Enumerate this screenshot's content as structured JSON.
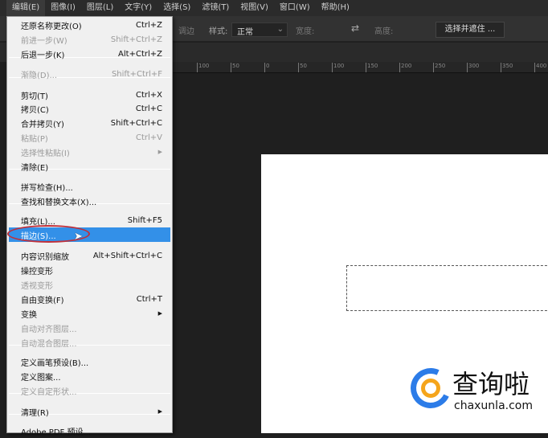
{
  "menubar": [
    "编辑(E)",
    "图像(I)",
    "图层(L)",
    "文字(Y)",
    "选择(S)",
    "滤镜(T)",
    "视图(V)",
    "窗口(W)",
    "帮助(H)"
  ],
  "options": {
    "feather_label": "调边",
    "style_label": "样式:",
    "style_value": "正常",
    "width_label": "宽度:",
    "height_label": "高度:",
    "select_mask_button": "选择并遮住 ..."
  },
  "ruler": [
    "100",
    "50",
    "0",
    "50",
    "100",
    "150",
    "200",
    "250",
    "300",
    "350",
    "400"
  ],
  "menu": [
    {
      "label": "还原名称更改(O)",
      "shortcut": "Ctrl+Z"
    },
    {
      "label": "前进一步(W)",
      "shortcut": "Shift+Ctrl+Z",
      "disabled": true
    },
    {
      "label": "后退一步(K)",
      "shortcut": "Alt+Ctrl+Z"
    },
    {
      "label": "渐隐(D)...",
      "shortcut": "Shift+Ctrl+F",
      "disabled": true
    },
    {
      "label": "剪切(T)",
      "shortcut": "Ctrl+X"
    },
    {
      "label": "拷贝(C)",
      "shortcut": "Ctrl+C"
    },
    {
      "label": "合并拷贝(Y)",
      "shortcut": "Shift+Ctrl+C"
    },
    {
      "label": "粘贴(P)",
      "shortcut": "Ctrl+V",
      "disabled": true
    },
    {
      "label": "选择性粘贴(I)",
      "shortcut": "▶",
      "disabled": true
    },
    {
      "label": "清除(E)",
      "shortcut": ""
    },
    {
      "label": "拼写检查(H)...",
      "shortcut": ""
    },
    {
      "label": "查找和替换文本(X)...",
      "shortcut": ""
    },
    {
      "label": "填充(L)...",
      "shortcut": "Shift+F5"
    },
    {
      "label": "描边(S)...",
      "shortcut": "",
      "highlighted": true
    },
    {
      "label": "内容识别缩放",
      "shortcut": "Alt+Shift+Ctrl+C"
    },
    {
      "label": "操控变形",
      "shortcut": ""
    },
    {
      "label": "透视变形",
      "shortcut": "",
      "disabled": true
    },
    {
      "label": "自由变换(F)",
      "shortcut": "Ctrl+T"
    },
    {
      "label": "变换",
      "shortcut": "▶"
    },
    {
      "label": "自动对齐图层...",
      "shortcut": "",
      "disabled": true
    },
    {
      "label": "自动混合图层...",
      "shortcut": "",
      "disabled": true
    },
    {
      "label": "定义画笔预设(B)...",
      "shortcut": ""
    },
    {
      "label": "定义图案...",
      "shortcut": ""
    },
    {
      "label": "定义自定形状...",
      "shortcut": "",
      "disabled": true
    },
    {
      "label": "清理(R)",
      "shortcut": "▶"
    },
    {
      "label": "Adobe PDF 预设...",
      "shortcut": ""
    }
  ],
  "watermark": {
    "name": "查询啦",
    "domain": "chaxunla.com"
  }
}
